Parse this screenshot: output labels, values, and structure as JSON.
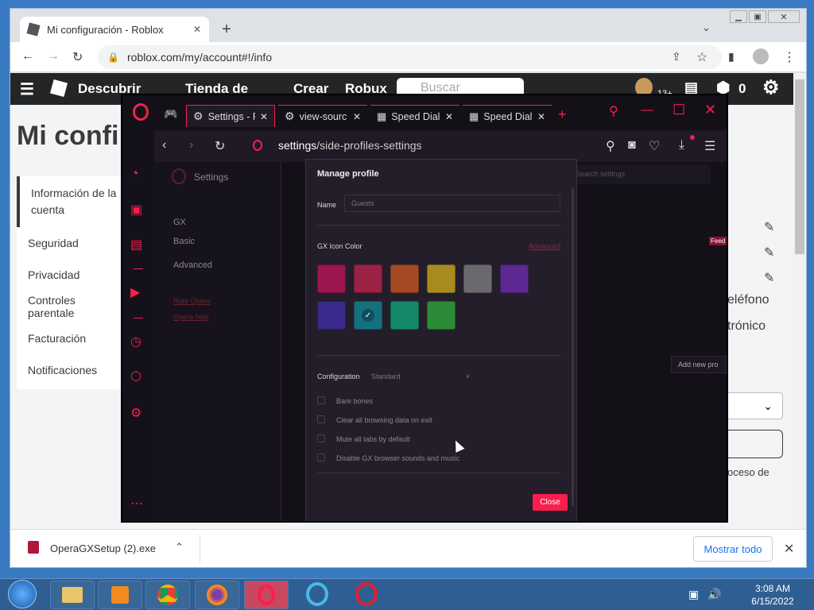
{
  "chrome": {
    "tab_title": "Mi configuración - Roblox",
    "url": "roblox.com/my/account#!/info",
    "new_tab": "+",
    "tab_close": "✕"
  },
  "roblox": {
    "nav": [
      "Descubrir",
      "Tienda de",
      "Crear",
      "Robux"
    ],
    "search_placeholder": "Buscar",
    "robux_count": "0",
    "badge": "13+",
    "page_title": "Mi confi",
    "sidebar": [
      "Información de la cuenta",
      "Seguridad",
      "Privacidad",
      "Controles parentale",
      "Facturación",
      "Notificaciones"
    ],
    "right_text": [
      "eléfono",
      "trónico",
      "oceso de"
    ]
  },
  "download": {
    "filename": "OperaGXSetup (2).exe",
    "show_all": "Mostrar todo"
  },
  "gx": {
    "tabs": [
      "Settings - P",
      "view-sourc",
      "Speed Dial",
      "Speed Dial"
    ],
    "url_bold": "settings",
    "url_rest": "/side-profiles-settings",
    "settings_title": "Settings",
    "search_placeholder": "Search settings",
    "nav": [
      "GX",
      "Basic",
      "Advanced",
      "Rate Opera",
      "Opera help"
    ],
    "feedback": "Feed",
    "add_new_profile": "Add new pro"
  },
  "modal": {
    "title": "Manage profile",
    "name_label": "Name",
    "name_placeholder": "Guests",
    "icon_color_label": "GX Icon Color",
    "advanced_link": "Advanced",
    "colors": [
      "#9c1650",
      "#9b2145",
      "#a44a25",
      "#a88a1f",
      "#6a6a6e",
      "#5d2891",
      "#3a2a8c",
      "#14707f",
      "#14896a",
      "#2a8a35"
    ],
    "selected_color_index": 7,
    "config_label": "Configuration",
    "config_value": "Standard",
    "options": [
      "Bare bones",
      "Clear all browsing data on exit",
      "Mute all tabs by default",
      "Disable GX browser sounds and music"
    ],
    "close_label": "Close"
  },
  "taskbar": {
    "time": "3:08 AM",
    "date": "6/15/2022"
  }
}
